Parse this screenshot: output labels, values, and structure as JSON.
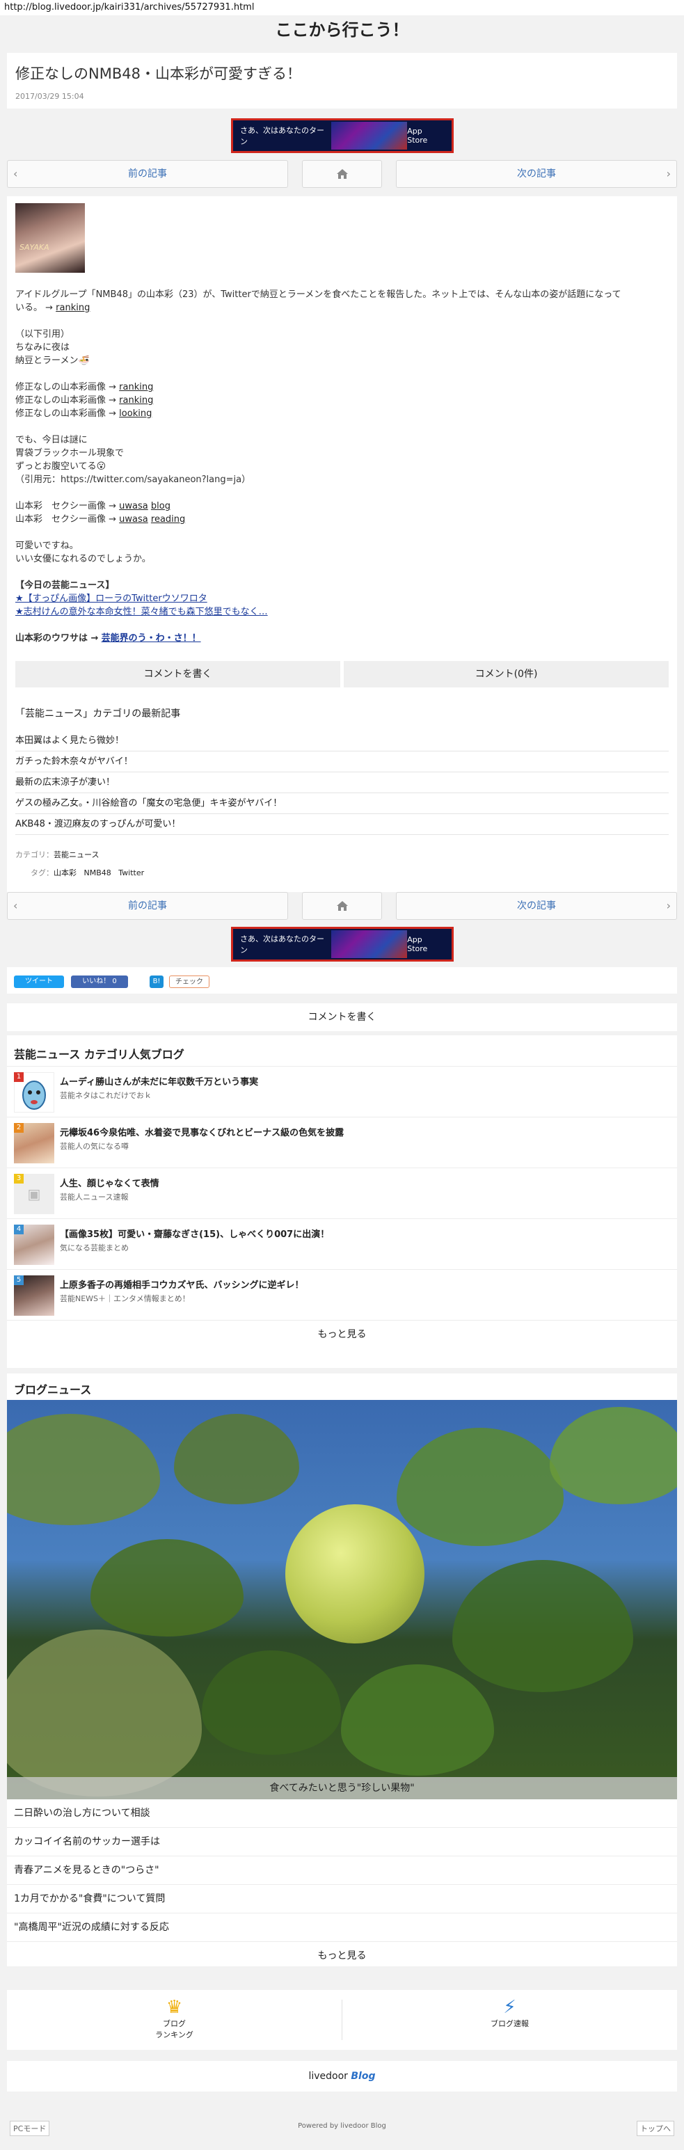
{
  "url": "http://blog.livedoor.jp/kairi331/archives/55727931.html",
  "blog_title": "ここから行こう！",
  "article": {
    "title": "修正なしのNMB48・山本彩が可愛すぎる！",
    "date": "2017/03/29 15:04"
  },
  "banner": {
    "text": "さあ、次はあなたのターン",
    "store": " App Store"
  },
  "pager": {
    "prev": "前の記事",
    "next": "次の記事",
    "home_icon": "home-icon"
  },
  "thumb_caption": "SAYAKA",
  "body": {
    "intro_1": "アイドルグループ「NMB48」の山本彩（23）が、Twitterで納豆とラーメンを食べたことを報告した。ネット上では、そんな山本の姿が話題になって",
    "intro_2": "いる。 →",
    "intro_link": "ranking",
    "quote_head": "（以下引用）",
    "quote_1": "ちなみに夜は",
    "quote_2": "納豆とラーメン🍜",
    "img_prefix": "修正なしの山本彩画像 →",
    "img_links": [
      "ranking",
      "ranking",
      "looking"
    ],
    "q2_1": "でも、今日は謎に",
    "q2_2": "胃袋ブラックホール現象で",
    "q2_3": "ずっとお腹空いてる😮",
    "q2_src": "（引用元：https://twitter.com/sayakaneon?lang=ja）",
    "sexy_prefix": "山本彩　セクシー画像 →",
    "sexy_1": [
      "uwasa",
      "blog"
    ],
    "sexy_2": [
      "uwasa",
      "reading"
    ],
    "end_1": "可愛いですね。",
    "end_2": "いい女優になれるのでしょうか。",
    "today_head": "【今日の芸能ニュース】",
    "today_1": "★【すっぴん画像】ローラのTwitterウソワロタ",
    "today_2": "★志村けんの意外な本命女性！菜々緒でも森下悠里でもなく…",
    "rumor_prefix": "山本彩のウワサは →",
    "rumor_link": "芸能界のう・わ・さ！！"
  },
  "comment": {
    "write": "コメントを書く",
    "count": "コメント(0件)"
  },
  "category": {
    "head": "「芸能ニュース」カテゴリの最新記事",
    "items": [
      "本田翼はよく見たら微妙！",
      "ガチった鈴木奈々がヤバイ！",
      "最新の広末涼子が凄い！",
      "ゲスの極み乙女。・川谷絵音の「魔女の宅急便」キキ姿がヤバイ！",
      "AKB48・渡辺麻友のすっぴんが可愛い！"
    ]
  },
  "meta": {
    "cat_label": "カテゴリ：",
    "cat_value": "芸能ニュース",
    "tag_label": "タグ：",
    "tags": [
      "山本彩",
      "NMB48",
      "Twitter"
    ]
  },
  "social": {
    "tweet": "ツイート",
    "like": "いいね！ 0",
    "hatena": "B!",
    "check": "チェック"
  },
  "comment_write_2": "コメントを書く",
  "ranking": {
    "title": "芸能ニュース カテゴリ人気ブログ",
    "items": [
      {
        "num": "1",
        "title": "ムーディ勝山さんが未だに年収数千万という事実",
        "sub": "芸能ネタはこれだけでおｋ"
      },
      {
        "num": "2",
        "title": "元欅坂46今泉佑唯、水着姿で見事なくびれとビーナス級の色気を披露",
        "sub": "芸能人の気になる噂"
      },
      {
        "num": "3",
        "title": "人生、顔じゃなくて表情",
        "sub": "芸能人ニュース速報"
      },
      {
        "num": "4",
        "title": "【画像35枚】可愛い・齋藤なぎさ(15)、しゃべくり007に出演！",
        "sub": "気になる芸能まとめ"
      },
      {
        "num": "5",
        "title": "上原多香子の再婚相手コウカズヤ氏、バッシングに逆ギレ！",
        "sub": "芸能NEWS＋｜エンタメ情報まとめ！"
      }
    ],
    "more": "もっと見る"
  },
  "news": {
    "title": "ブログニュース",
    "caption": "食べてみたいと思う\"珍しい果物\"",
    "items": [
      "二日酔いの治し方について相談",
      "カッコイイ名前のサッカー選手は",
      "青春アニメを見るときの\"つらさ\"",
      "1カ月でかかる\"食費\"について質問",
      "\"高橋周平\"近況の成績に対する反応"
    ],
    "more": "もっと見る"
  },
  "footer_nav": {
    "ranking_icon": "crown-icon",
    "ranking_1": "ブログ",
    "ranking_2": "ランキング",
    "breaking_icon": "lightning-icon",
    "breaking": "ブログ速報"
  },
  "logo": {
    "a": "livedoor",
    "b": "Blog"
  },
  "bottom": {
    "pc_mode": "PCモード",
    "powered": "Powered by livedoor Blog",
    "top": "トップへ"
  },
  "colors": {
    "link": "#3a6fb5",
    "ranking_badges": [
      "#d9342b",
      "#e8891e",
      "#f0c419",
      "#3a8fd0",
      "#3a8fd0"
    ]
  }
}
